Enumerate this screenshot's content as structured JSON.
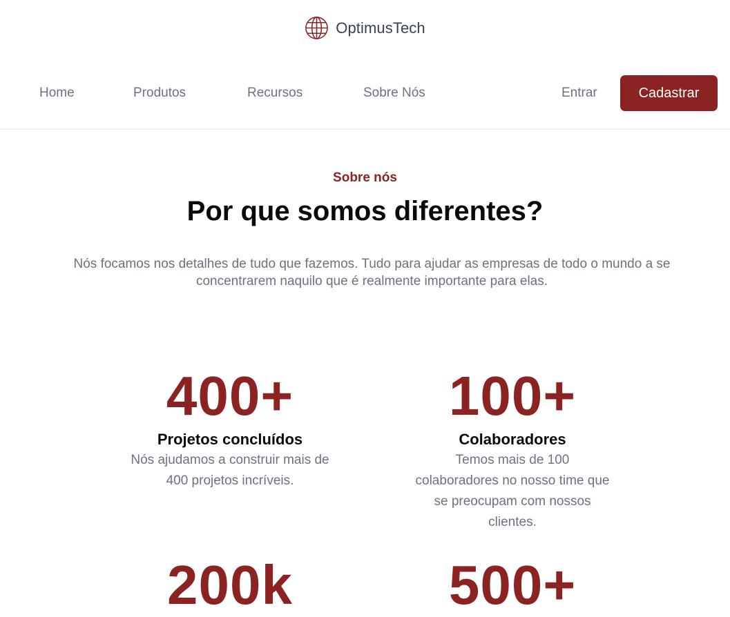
{
  "brand": {
    "name": "OptimusTech",
    "icon": "globe-icon",
    "accent": "#8b2323"
  },
  "nav": {
    "items": [
      {
        "label": "Home"
      },
      {
        "label": "Produtos"
      },
      {
        "label": "Recursos"
      },
      {
        "label": "Sobre Nós"
      }
    ],
    "login_label": "Entrar",
    "signup_label": "Cadastrar"
  },
  "about": {
    "eyebrow": "Sobre nós",
    "title": "Por que somos diferentes?",
    "description": "Nós focamos nos detalhes de tudo que fazemos. Tudo para ajudar as empresas de todo o mundo a se concentrarem naquilo que é realmente importante para elas."
  },
  "stats": [
    {
      "value": "400+",
      "title": "Projetos concluídos",
      "description": "Nós ajudamos a construir mais de 400 projetos incríveis."
    },
    {
      "value": "100+",
      "title": "Colaboradores",
      "description": "Temos mais de 100 colaboradores no nosso time que se preocupam com nossos clientes."
    },
    {
      "value": "200k",
      "title": "",
      "description": ""
    },
    {
      "value": "500+",
      "title": "",
      "description": ""
    }
  ]
}
